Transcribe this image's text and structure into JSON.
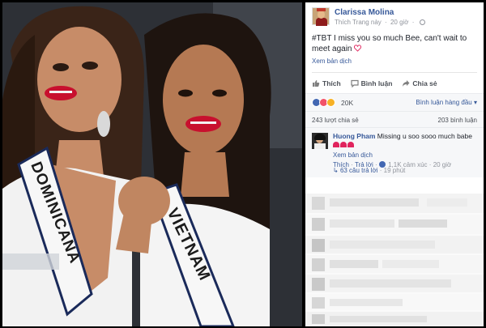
{
  "post": {
    "author": "Clarissa Molina",
    "like_page": "Thích Trang này",
    "time": "20 giờ",
    "text": "#TBT I miss you so much Bee, can't wait to meet again",
    "see_translation": "Xem bản dịch"
  },
  "actions": {
    "like": "Thích",
    "comment": "Bình luận",
    "share": "Chia sẻ"
  },
  "reactions": {
    "count": "20K",
    "sort_label": "Bình luận hàng đầu ▾"
  },
  "stats": {
    "shares": "243 lượt chia sẻ",
    "comments": "203 bình luận"
  },
  "comment": {
    "name": "Huong Pham",
    "text": "Missing u soo sooo much babe",
    "see_translation": "Xem bản dịch",
    "like": "Thích",
    "reply": "Trả lời",
    "reaction_count": "1,1K cảm xúc",
    "time": "20 giờ",
    "replies": "63 câu trả lời",
    "replies_time": "19 phút"
  },
  "photo": {
    "sash_left": "DOMINICANA",
    "sash_right": "VIETNAM"
  },
  "colors": {
    "link": "#365899",
    "like_blue": "#4267b2",
    "love_red": "#e0245e",
    "panel_bg": "#f6f7f9"
  },
  "icons": {
    "like": "thumbs-up-icon",
    "comment": "comment-bubble-icon",
    "share": "share-arrow-icon",
    "heart": "heart-icon",
    "globe": "globe-icon"
  }
}
